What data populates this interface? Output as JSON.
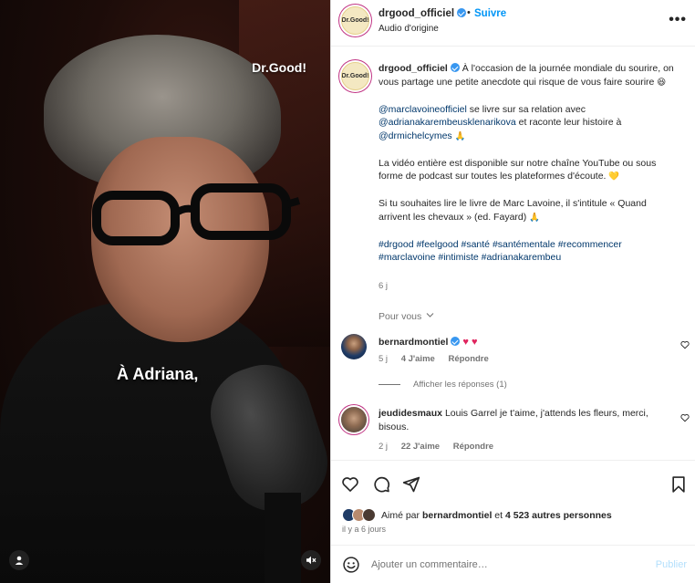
{
  "media": {
    "brand_text": "Dr.Good!",
    "caption_text": "À Adriana,",
    "left_control_icon": "user-icon",
    "right_control_icon": "speaker-muted-icon"
  },
  "header": {
    "avatar_text": "Dr.Good!",
    "username": "drgood_officiel",
    "dot": "•",
    "follow": "Suivre",
    "audio": "Audio d'origine",
    "more": "•••"
  },
  "post": {
    "avatar_text": "Dr.Good!",
    "username": "drgood_officiel",
    "intro": "À l'occasion de la journée mondiale du sourire, on vous partage une petite anecdote qui risque de vous faire sourire",
    "intro_emoji": "😆",
    "p2_mention1": "@marclavoineofficiel",
    "p2_text1": " se livre sur sa relation avec ",
    "p2_mention2": "@adrianakarembeusklenarikova",
    "p2_text2": " et raconte leur histoire à ",
    "p2_mention3": "@drmichelcymes",
    "p2_emoji": "🙏",
    "p3_text": "La vidéo entière est disponible sur notre chaîne YouTube ou sous forme de podcast sur toutes les plateformes d'écoute.",
    "p3_emoji": "💛",
    "p4_text": "Si tu souhaites lire le livre de Marc Lavoine, il s'intitule « Quand arrivent les chevaux » (ed. Fayard)",
    "p4_emoji": "🙏",
    "hashtags": "#drgood #feelgood #santé #santémentale #recommencer #marclavoine #intimiste #adrianakarembeu",
    "time": "6 j"
  },
  "for_you": "Pour vous",
  "comments": [
    {
      "username": "bernardmontiel",
      "text": "",
      "hearts": "♥ ♥",
      "time": "5 j",
      "likes": "4 J'aime",
      "reply": "Répondre",
      "view_replies": "Afficher les réponses (1)"
    },
    {
      "username": "jeudidesmaux",
      "text": "Louis Garrel je t'aime, j'attends les fleurs, merci, bisous.",
      "time": "2 j",
      "likes": "22 J'aime",
      "reply": "Répondre"
    }
  ],
  "actions": {
    "like_icon": "heart-icon",
    "comment_icon": "comment-icon",
    "share_icon": "share-icon",
    "save_icon": "bookmark-icon",
    "liked_by_prefix": "Aimé par",
    "liked_by_user": "bernardmontiel",
    "liked_by_and": "et",
    "liked_by_others": "4 523 autres personnes",
    "when": "il y a 6 jours",
    "comment_placeholder": "Ajouter un commentaire…",
    "publish": "Publier"
  },
  "colors": {
    "accent": "#0095f6",
    "mention": "#00376b",
    "muted": "#737373",
    "heart": "#e0245e"
  }
}
